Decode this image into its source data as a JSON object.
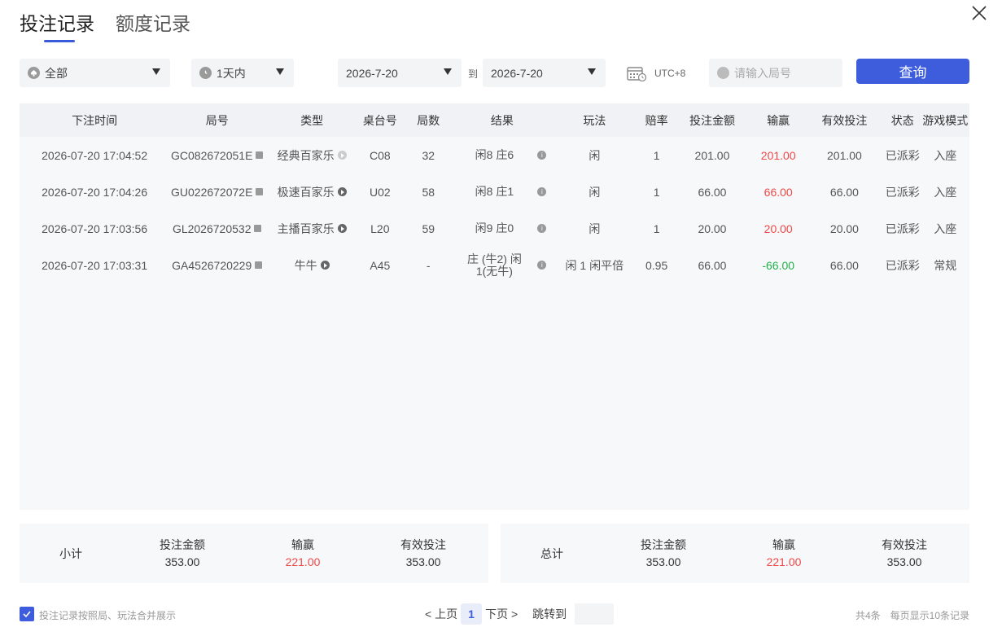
{
  "tabs": [
    {
      "label": "投注记录"
    },
    {
      "label": "额度记录"
    }
  ],
  "filters": {
    "game_filter": "全部",
    "time_filter": "1天内",
    "date_from": "2026-7-20",
    "to_label": "到",
    "date_to": "2026-7-20",
    "timezone": "UTC+8",
    "round_placeholder": "请输入局号",
    "search_label": "查询"
  },
  "table": {
    "headers": [
      "下注时间",
      "局号",
      "类型",
      "桌台号",
      "局数",
      "结果",
      "玩法",
      "赔率",
      "投注金额",
      "输赢",
      "有效投注",
      "状态",
      "游戏模式"
    ],
    "rows": [
      {
        "time": "2026-07-20 17:04:52",
        "round": "GC082672051E",
        "type": "经典百家乐",
        "table": "C08",
        "game_no": "32",
        "result": "闲8 庄6",
        "play": "闲",
        "odds": "1",
        "bet": "201.00",
        "win": "201.00",
        "valid": "201.00",
        "status": "已派彩",
        "mode": "入座"
      },
      {
        "time": "2026-07-20 17:04:26",
        "round": "GU022672072E",
        "type": "极速百家乐",
        "table": "U02",
        "game_no": "58",
        "result": "闲8 庄1",
        "play": "闲",
        "odds": "1",
        "bet": "66.00",
        "win": "66.00",
        "valid": "66.00",
        "status": "已派彩",
        "mode": "入座"
      },
      {
        "time": "2026-07-20 17:03:56",
        "round": "GL2026720532",
        "type": "主播百家乐",
        "table": "L20",
        "game_no": "59",
        "result": "闲9 庄0",
        "play": "闲",
        "odds": "1",
        "bet": "20.00",
        "win": "20.00",
        "valid": "20.00",
        "status": "已派彩",
        "mode": "入座"
      },
      {
        "time": "2026-07-20 17:03:31",
        "round": "GA4526720229",
        "type": "牛牛",
        "table": "A45",
        "game_no": "-",
        "result": "庄 (牛2) 闲1(无牛)",
        "play": "闲 1 闲平倍",
        "odds": "0.95",
        "bet": "66.00",
        "win": "-66.00",
        "valid": "66.00",
        "status": "已派彩",
        "mode": "常规"
      }
    ]
  },
  "subtotal": {
    "label": "小计",
    "bet_label": "投注金额",
    "bet": "353.00",
    "win_label": "输赢",
    "win": "221.00",
    "valid_label": "有效投注",
    "valid": "353.00"
  },
  "total": {
    "label": "总计",
    "bet_label": "投注金额",
    "bet": "353.00",
    "win_label": "输赢",
    "win": "221.00",
    "valid_label": "有效投注",
    "valid": "353.00"
  },
  "footer": {
    "merge_label": "投注记录按照局、玩法合并展示",
    "prev": "< 上页",
    "current_page": "1",
    "next": "下页 >",
    "jump_label": "跳转到",
    "total_count": "共4条",
    "per_page": "每页显示10条记录"
  },
  "colors": {
    "accent": "#3d5ddc",
    "positive": "#f04848",
    "negative": "#20b24a"
  }
}
